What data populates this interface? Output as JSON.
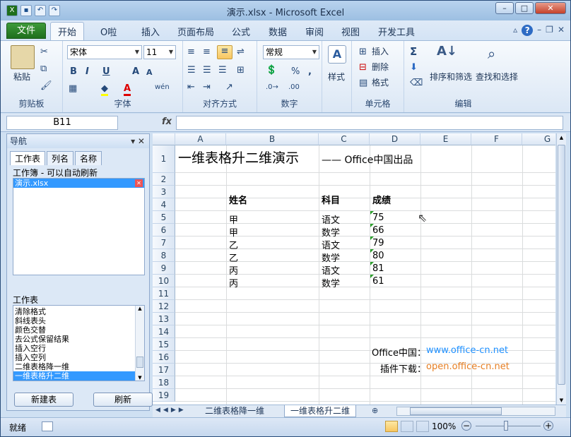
{
  "window": {
    "title": "演示.xlsx - Microsoft Excel"
  },
  "ribbon_tabs": [
    "文件",
    "开始",
    "O啦",
    "插入",
    "页面布局",
    "公式",
    "数据",
    "审阅",
    "视图",
    "开发工具"
  ],
  "font": {
    "name": "宋体",
    "size": "11"
  },
  "number_format": "常规",
  "groups": {
    "clipboard": "剪贴板",
    "font": "字体",
    "alignment": "对齐方式",
    "number": "数字",
    "cells": "单元格",
    "editing": "编辑"
  },
  "labels": {
    "paste": "粘贴",
    "styles": "样式",
    "insert": "插入",
    "delete": "删除",
    "format": "格式",
    "sort": "排序和筛选",
    "find": "查找和选择",
    "percent": "%"
  },
  "formula_bar": {
    "name_box": "B11",
    "fx": "fx",
    "content": ""
  },
  "nav": {
    "title": "导航",
    "tabs": [
      "工作表",
      "列名",
      "名称"
    ],
    "workbook_label": "工作簿 - 可以自动刷新",
    "workbooks": [
      "演示.xlsx"
    ],
    "sheets_label": "工作表",
    "sheets": [
      "清除格式",
      "斜线表头",
      "颜色交替",
      "去公式保留结果",
      "插入空行",
      "插入空列",
      "二维表格降一维",
      "一维表格升二维"
    ],
    "selected_sheet": "一维表格升二维",
    "btn_new": "新建表",
    "btn_refresh": "刷新"
  },
  "columns": [
    "A",
    "B",
    "C",
    "D",
    "E",
    "F",
    "G"
  ],
  "rows": [
    "1",
    "2",
    "3",
    "4",
    "5",
    "6",
    "7",
    "8",
    "9",
    "10",
    "11",
    "12",
    "13",
    "14",
    "15",
    "16",
    "17",
    "18",
    "19"
  ],
  "cells": {
    "title": "一维表格升二维演示",
    "subtitle": "—— Office中国出品",
    "headers": [
      "姓名",
      "科目",
      "成绩"
    ],
    "data": [
      [
        "甲",
        "语文",
        "75"
      ],
      [
        "甲",
        "数学",
        "66"
      ],
      [
        "乙",
        "语文",
        "79"
      ],
      [
        "乙",
        "数学",
        "80"
      ],
      [
        "丙",
        "语文",
        "81"
      ],
      [
        "丙",
        "数学",
        "61"
      ]
    ],
    "office_label": "Office中国：",
    "office_url": "www.office-cn.net",
    "plugin_label": "插件下载：",
    "plugin_url": "open.office-cn.net"
  },
  "sheet_tabs": [
    "二维表格降一维",
    "一维表格升二维"
  ],
  "status": {
    "ready": "就绪",
    "zoom": "100%"
  },
  "colors": {
    "file_tab": "#2e8b2e",
    "link_blue": "#1e90ff",
    "link_orange": "#e67e22",
    "selected": "#3399ff"
  }
}
